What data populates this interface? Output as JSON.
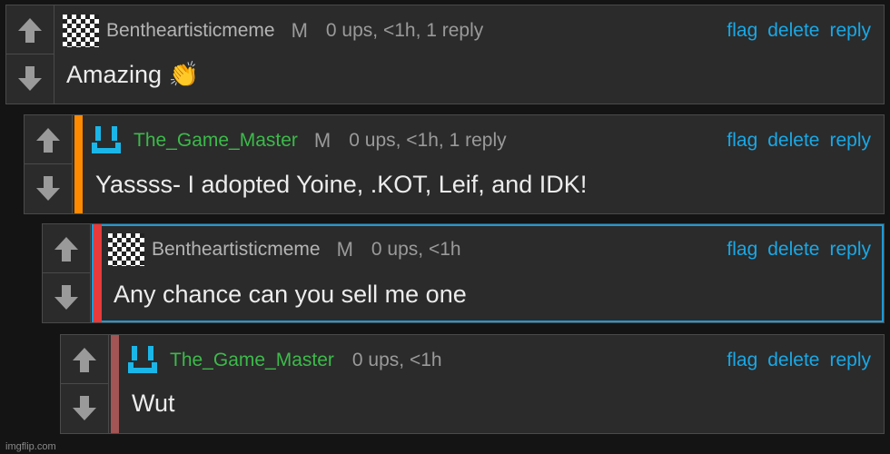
{
  "comments": [
    {
      "username": "Bentheartisticmeme",
      "badge": "M",
      "meta": "0 ups, <1h, 1 reply",
      "text": "Amazing 👏",
      "actions": {
        "flag": "flag",
        "delete": "delete",
        "reply": "reply"
      }
    },
    {
      "username": "The_Game_Master",
      "badge": "M",
      "meta": "0 ups, <1h, 1 reply",
      "text": "Yassss- I adopted Yoine, .KOT, Leif, and IDK!",
      "actions": {
        "flag": "flag",
        "delete": "delete",
        "reply": "reply"
      }
    },
    {
      "username": "Bentheartisticmeme",
      "badge": "M",
      "meta": "0 ups, <1h",
      "text": "Any chance can you sell me one",
      "actions": {
        "flag": "flag",
        "delete": "delete",
        "reply": "reply"
      }
    },
    {
      "username": "The_Game_Master",
      "meta": "0 ups, <1h",
      "text": "Wut",
      "actions": {
        "flag": "flag",
        "delete": "delete",
        "reply": "reply"
      }
    }
  ],
  "thread_colors": {
    "level1": "#ff8a00",
    "level2": "#e83a3a",
    "level3": "#a35454",
    "highlight_border": "#1e9ad6",
    "username_green": "#3cba4a",
    "link_blue": "#19a8e6"
  },
  "icons": {
    "upvote": "arrow-up-icon",
    "downvote": "arrow-down-icon",
    "avatar_checker": "checkerboard-avatar-icon",
    "avatar_face": "cyan-face-avatar-icon"
  },
  "watermark": "imgflip.com"
}
